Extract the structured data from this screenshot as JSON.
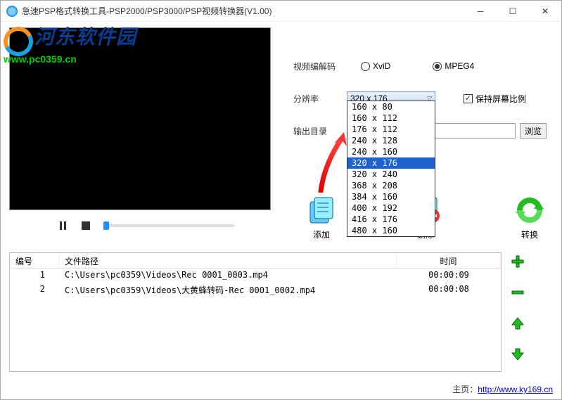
{
  "window": {
    "title": "急速PSP格式转换工具-PSP2000/PSP3000/PSP视频转换器(V1.00)"
  },
  "watermark": {
    "text": "河东软件园",
    "url": "www.pc0359.cn"
  },
  "codec": {
    "label": "视频编解码",
    "opt1": "XviD",
    "opt2": "MPEG4"
  },
  "resolution": {
    "label": "分辨率",
    "selected": "320 x 176",
    "keep_ratio": "保持屏幕比例",
    "options": [
      "160 x 80",
      "160 x 112",
      "176 x 112",
      "240 x 128",
      "240 x 160",
      "320 x 176",
      "320 x 240",
      "368 x 208",
      "384 x 160",
      "400 x 192",
      "416 x 176",
      "480 x 160"
    ]
  },
  "output": {
    "label": "输出目录",
    "path": "",
    "browse": "浏览"
  },
  "buttons": {
    "add": "添加",
    "delete": "删除",
    "convert": "转换"
  },
  "table": {
    "h1": "编号",
    "h2": "文件路径",
    "h3": "时间",
    "rows": [
      {
        "n": "1",
        "path": "C:\\Users\\pc0359\\Videos\\Rec 0001_0003.mp4",
        "time": "00:00:09"
      },
      {
        "n": "2",
        "path": "C:\\Users\\pc0359\\Videos\\大黄蜂转码-Rec 0001_0002.mp4",
        "time": "00:00:08"
      }
    ]
  },
  "footer": {
    "label": "主页：",
    "url": "http://www.ky169.cn"
  }
}
